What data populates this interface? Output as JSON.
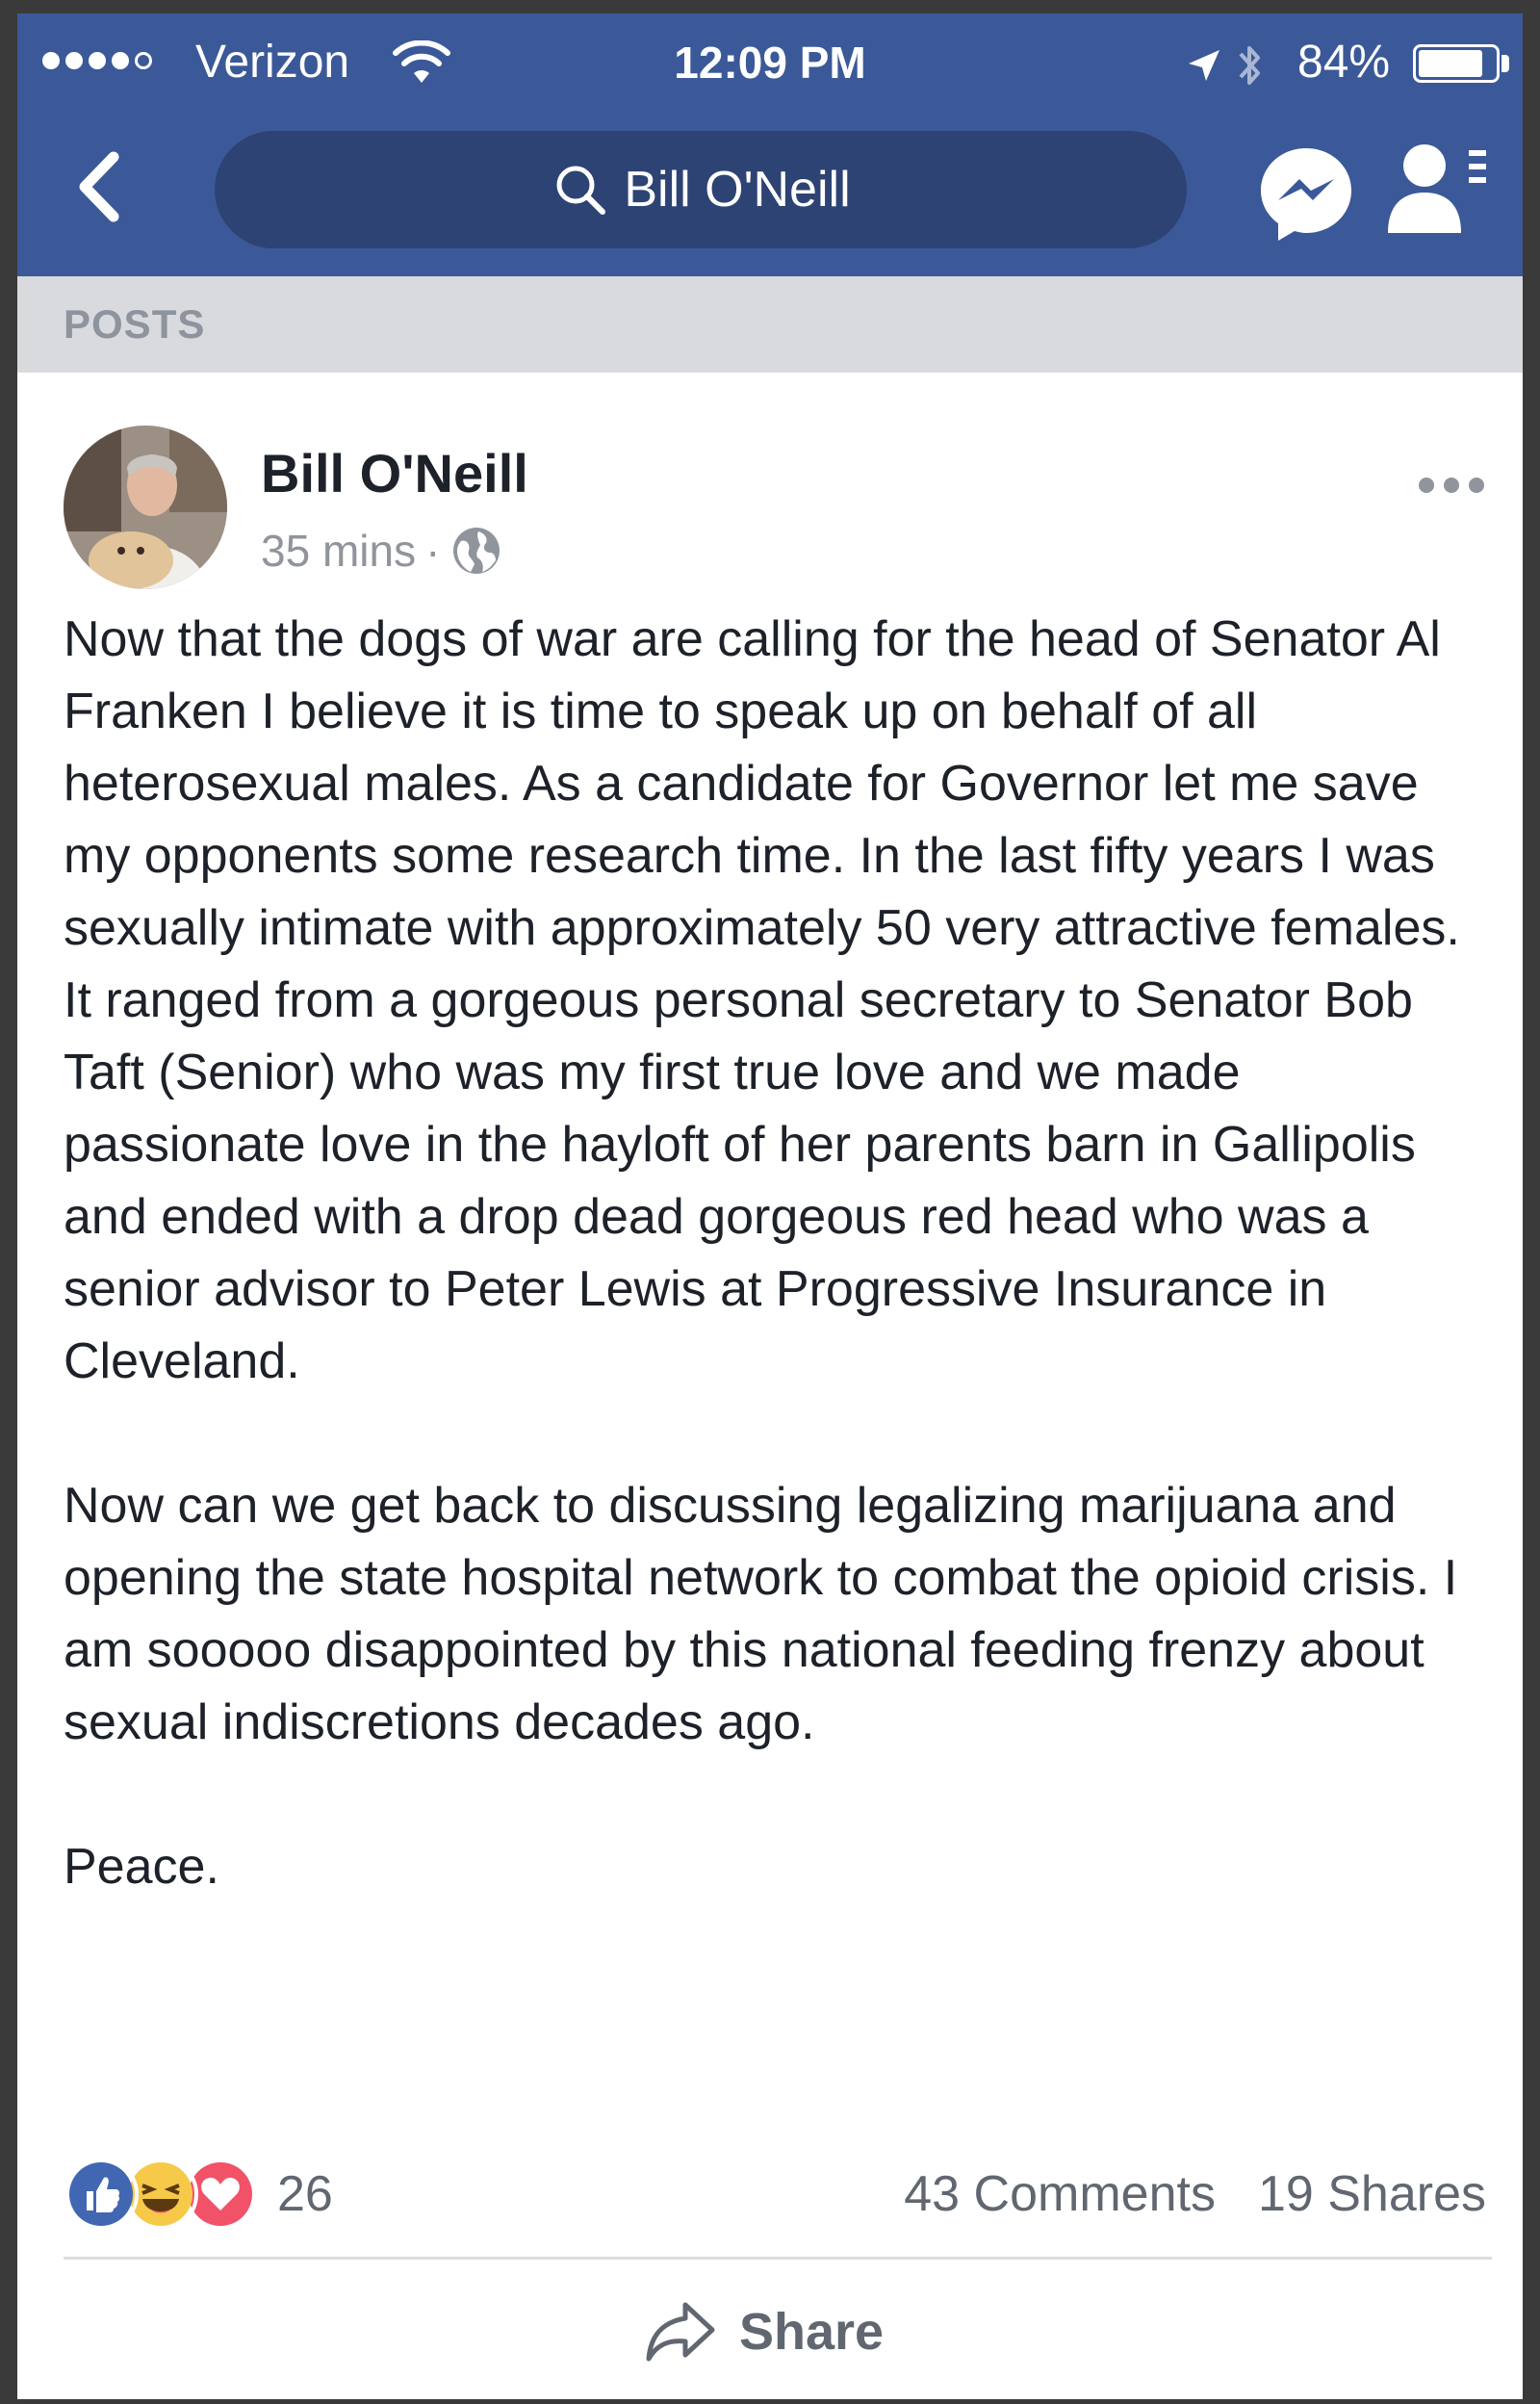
{
  "status_bar": {
    "carrier": "Verizon",
    "time": "12:09 PM",
    "battery_percent": "84%",
    "battery_level": 0.84,
    "signal_bars_filled": 4,
    "signal_bars_total": 5
  },
  "nav": {
    "search_text": "Bill O'Neill",
    "icons": [
      "back-chevron-icon",
      "search-icon",
      "messenger-icon",
      "friends-icon"
    ]
  },
  "section_label": "POSTS",
  "post": {
    "author": "Bill O'Neill",
    "timestamp": "35 mins",
    "separator": "·",
    "privacy_icon": "globe-icon",
    "paragraphs": [
      "Now that the dogs of war are calling for the head of Senator Al Franken I believe it is time to speak up on behalf of all heterosexual males.  As a candidate for Governor let me save my opponents some research time. In the last fifty years I was sexually intimate with approximately 50 very attractive females.  It ranged from a gorgeous personal secretary to Senator Bob Taft (Senior) who was my first true love and we made passionate love in the hayloft of her parents barn in Gallipolis and ended with a drop dead gorgeous red head who was a senior advisor to Peter Lewis at Progressive Insurance in Cleveland.",
      "Now can we get back to discussing legalizing marijuana and opening the state hospital network to combat the opioid crisis.  I am sooooo disappointed by this national feeding frenzy about sexual indiscretions decades ago.",
      "Peace."
    ],
    "reactions": {
      "types": [
        "like",
        "haha",
        "love"
      ],
      "count": "26"
    },
    "comments": "43 Comments",
    "shares": "19 Shares",
    "share_action": "Share"
  },
  "colors": {
    "brand_blue": "#3b5998",
    "search_bg": "#2d4373",
    "section_bar": "#d9dadd",
    "text": "#1d2129",
    "muted": "#90949c",
    "like": "#4267b2",
    "haha": "#f7c949",
    "love": "#f25268"
  }
}
